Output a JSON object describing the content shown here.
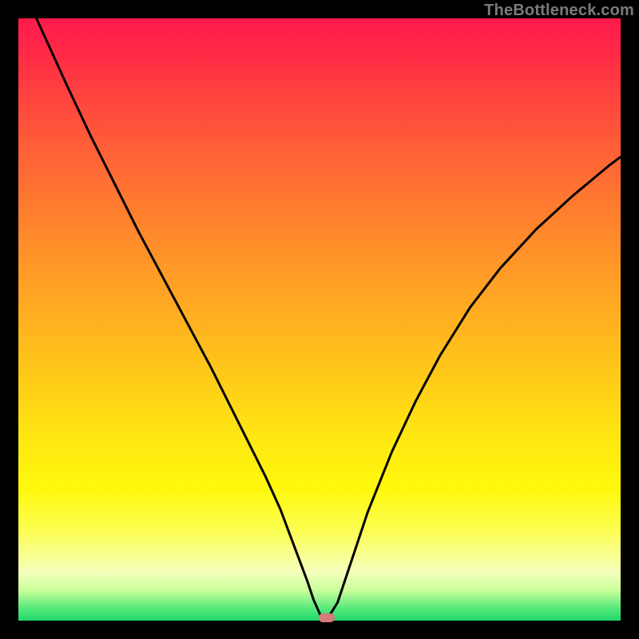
{
  "watermark": "TheBottleneck.com",
  "colors": {
    "frame": "#000000",
    "curve": "#000000",
    "marker": "#d87a7a",
    "watermark": "#7a7a7a",
    "gradient_top": "#ff1a4d",
    "gradient_bottom": "#1fd76a"
  },
  "chart_data": {
    "type": "line",
    "title": "",
    "xlabel": "",
    "ylabel": "",
    "xlim": [
      0,
      100
    ],
    "ylim": [
      0,
      100
    ],
    "grid": false,
    "series": [
      {
        "name": "bottleneck-curve",
        "x": [
          3,
          8,
          12,
          16,
          20,
          24,
          28,
          32,
          35,
          38,
          41,
          43.5,
          45,
          46.5,
          48,
          49,
          50.2,
          51.5,
          53,
          55,
          58,
          62,
          66,
          70,
          75,
          80,
          86,
          92,
          98,
          100
        ],
        "y": [
          100,
          89,
          80.5,
          72.5,
          64.5,
          57,
          49.5,
          42,
          36,
          30,
          24,
          18.5,
          14.5,
          10.5,
          6.5,
          3.5,
          0.8,
          0.6,
          3,
          9,
          18,
          28,
          36.5,
          44,
          52,
          58.5,
          65,
          70.5,
          75.5,
          77
        ]
      }
    ],
    "marker": {
      "x": 51.2,
      "y": 0.5
    },
    "legend": false
  }
}
